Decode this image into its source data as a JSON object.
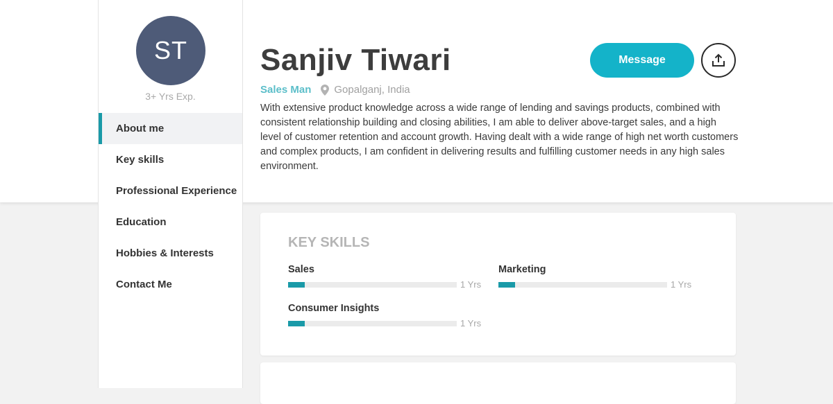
{
  "sidebar": {
    "avatar_initials": "ST",
    "experience": "3+ Yrs Exp.",
    "nav": [
      {
        "label": "About me",
        "active": true
      },
      {
        "label": "Key skills",
        "active": false
      },
      {
        "label": "Professional Experience",
        "active": false
      },
      {
        "label": "Education",
        "active": false
      },
      {
        "label": "Hobbies & Interests",
        "active": false
      },
      {
        "label": "Contact Me",
        "active": false
      }
    ]
  },
  "profile": {
    "name": "Sanjiv Tiwari",
    "role": "Sales Man",
    "location_icon": "map-pin-icon",
    "location": "Gopalganj, India",
    "bio": "With extensive product knowledge across a wide range of lending and savings products, combined with consistent relationship building and closing abilities, I am able to deliver above-target sales, and a high level of customer retention and account growth. Having dealt with a wide range of high net worth customers and complex products, I am confident in delivering results and fulfilling customer needs in any high sales environment.",
    "message_label": "Message",
    "share_icon": "share-upload-icon"
  },
  "key_skills": {
    "title": "KEY SKILLS",
    "skills": [
      {
        "name": "Sales",
        "years": "1 Yrs",
        "level": 0.1
      },
      {
        "name": "Marketing",
        "years": "1 Yrs",
        "level": 0.1
      },
      {
        "name": "Consumer Insights",
        "years": "1 Yrs",
        "level": 0.1
      }
    ]
  },
  "colors": {
    "accent": "#1a9aa8",
    "button": "#14b3c9",
    "avatar": "#4e5b78",
    "role": "#5bbec9"
  }
}
